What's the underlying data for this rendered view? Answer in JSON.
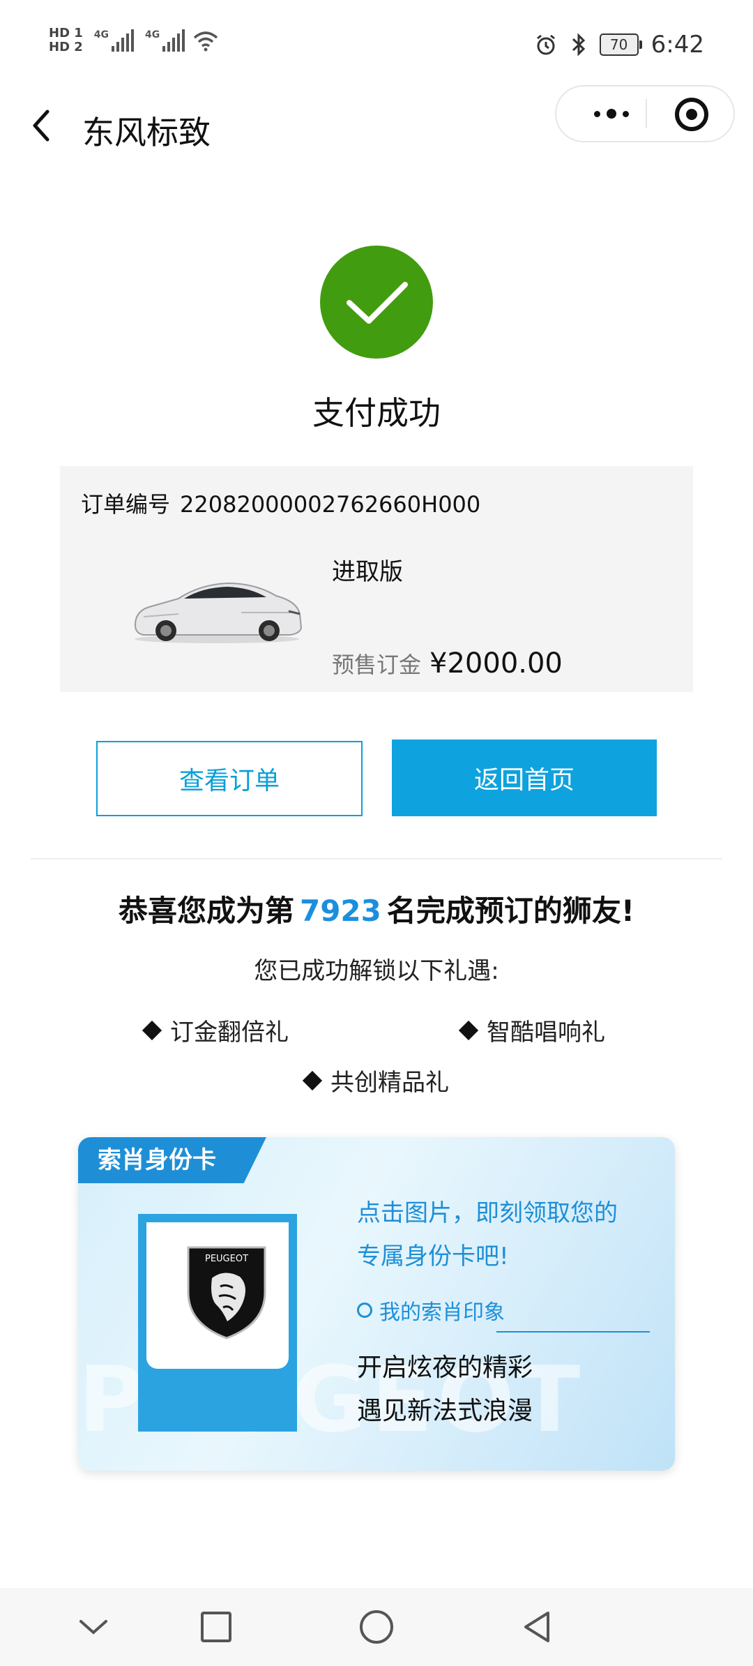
{
  "status_bar": {
    "hd1": "HD 1",
    "hd2": "HD 2",
    "net1": "4G",
    "net2": "4G",
    "battery": "70",
    "time": "6:42"
  },
  "nav": {
    "title": "东风标致",
    "back_icon": "chevron-left-icon",
    "more_icon": "more-dots-icon",
    "close_icon": "target-icon"
  },
  "result": {
    "title": "支付成功",
    "icon": "check-icon",
    "icon_color": "#429c0f"
  },
  "order": {
    "number_label": "订单编号",
    "number": "22082000002762660H000",
    "trim": "进取版",
    "deposit_label": "预售订金",
    "deposit": "¥2000.00"
  },
  "buttons": {
    "view_order": "查看订单",
    "back_home": "返回首页",
    "accent": "#0ea2de"
  },
  "congrats": {
    "prefix": "恭喜您成为第",
    "rank": "7923",
    "suffix": "名完成预订的狮友!",
    "unlock": "您已成功解锁以下礼遇:",
    "gifts": [
      "订金翻倍礼",
      "智酷唱响礼",
      "共创精品礼"
    ]
  },
  "banner": {
    "tag": "索肖身份卡",
    "cta_line1": "点击图片，即刻领取您的",
    "cta_line2": "专属身份卡吧!",
    "impression": "我的索肖印象",
    "tagline1": "开启炫夜的精彩",
    "tagline2": "遇见新法式浪漫",
    "logo_text": "PEUGEOT",
    "watermark": "PEUGEOT"
  },
  "system_nav": {
    "icons": [
      "chevron-down-icon",
      "square-icon",
      "circle-icon",
      "triangle-back-icon"
    ]
  }
}
